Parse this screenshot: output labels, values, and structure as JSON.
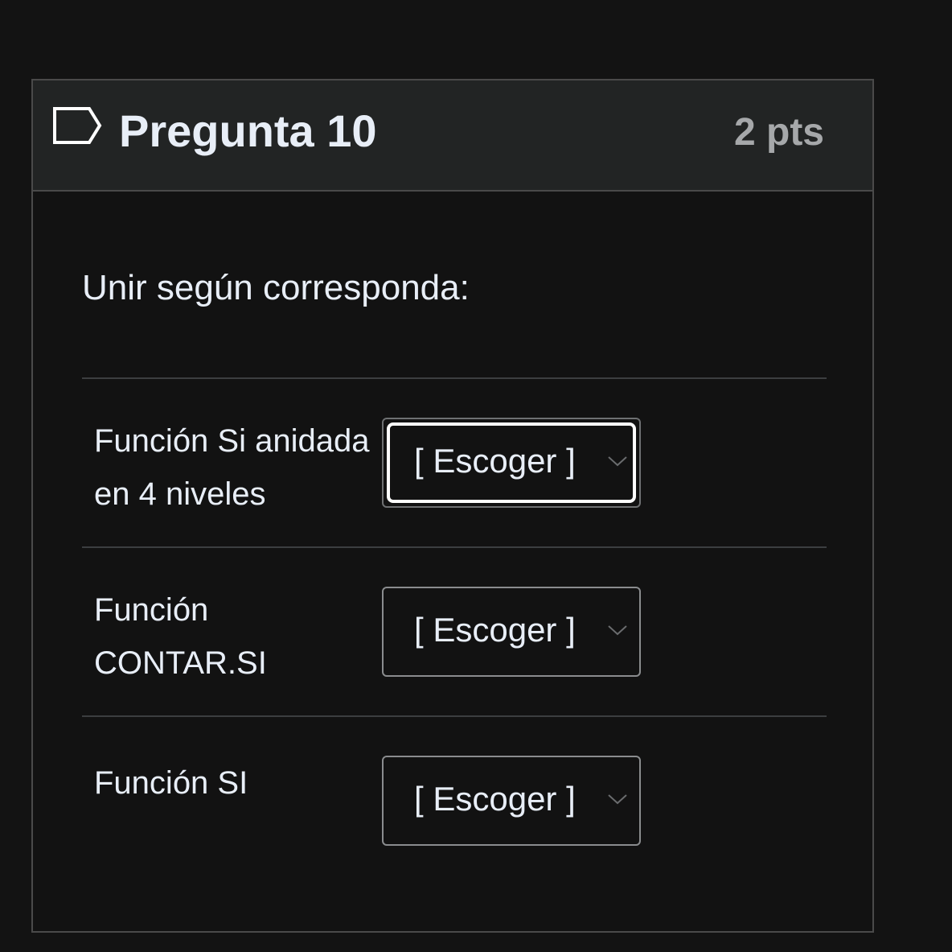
{
  "question": {
    "title": "Pregunta 10",
    "points": "2 pts",
    "text": "Unir según corresponda:",
    "flag_icon": "flag-outline-icon"
  },
  "matches": [
    {
      "label": "Función Si anidada en 4 niveles",
      "selected": "[ Escoger ]",
      "focused": true
    },
    {
      "label": "Función CONTAR.SI",
      "selected": "[ Escoger ]",
      "focused": false
    },
    {
      "label": "Función SI",
      "selected": "[ Escoger ]",
      "focused": false
    }
  ],
  "colors": {
    "background": "#131313",
    "header_bg": "#222424",
    "text": "#e8eef7",
    "muted": "#a6a8aa",
    "border": "#4a4a4a"
  }
}
